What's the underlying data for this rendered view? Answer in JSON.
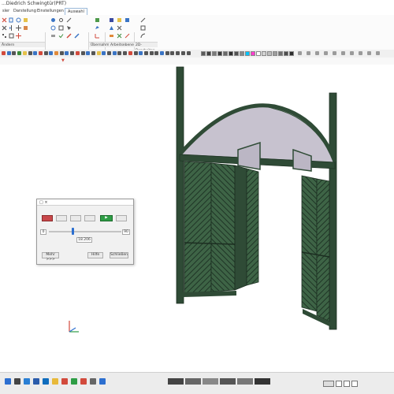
{
  "window": {
    "title": "...Diedrich Schwingtür(PRT)",
    "tabs": [
      "sler",
      "Darstellung",
      "Einstellungen",
      "Auswahl"
    ],
    "active_tab_index": 3
  },
  "ribbon": {
    "group_labels": [
      "Ändern",
      "Übernahmen",
      "Arbeitsebenen",
      "2D-Bearbeiten"
    ]
  },
  "toolbar": {
    "colors": [
      "#5a5a5a",
      "#404040",
      "#7a7a7a",
      "#3a3a3a",
      "#6a6a6a",
      "#2e2e2e",
      "#505050",
      "#8a8a8a",
      "#00c6ff",
      "#ff3ccf",
      "#ffffff",
      "#d4d4d4",
      "#bdbdbd",
      "#9e9e9e",
      "#707070",
      "#4e4e4e",
      "#2b2b2b"
    ]
  },
  "dialog": {
    "title": "□ ×",
    "field_left": "0",
    "field_right": "90",
    "field_value": "18.206",
    "buttons": {
      "apply": "Hilfe",
      "close": "Schließen",
      "more": "Mehr >>>"
    },
    "slider_level": 0.33
  },
  "taskbar": {
    "icons": [
      "windows-icon",
      "search-icon",
      "mail-icon",
      "word-icon",
      "outlook-icon",
      "explorer-icon",
      "chrome-icon",
      "store-icon",
      "app-icon",
      "settings-icon",
      "extra-icon"
    ]
  },
  "colors": {
    "door_green": "#2f4b36",
    "glass_fill": "#c7c2cf",
    "accent_blue": "#2c6fd0"
  }
}
